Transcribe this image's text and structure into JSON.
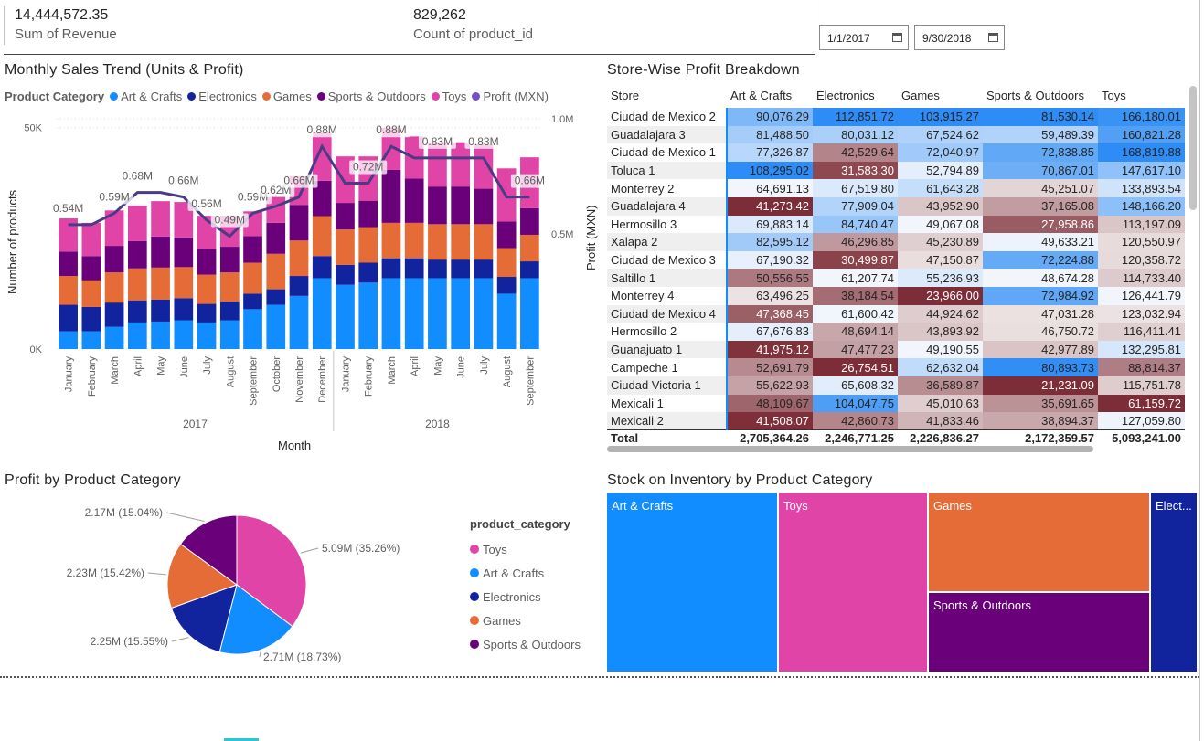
{
  "kpis": [
    {
      "value": "14,444,572.35",
      "label": "Sum of Revenue"
    },
    {
      "value": "829,262",
      "label": "Count of product_id"
    }
  ],
  "date_range": {
    "start": "1/1/2017",
    "end": "9/30/2018"
  },
  "colors": {
    "art_crafts": "#118DFF",
    "electronics": "#12239E",
    "games": "#E66C37",
    "sports_outdoors": "#6B007B",
    "toys": "#E044A7",
    "profit_line": "#744EC2"
  },
  "monthly": {
    "title": "Monthly Sales Trend (Units & Profit)",
    "legend_title": "Product Category",
    "legend": [
      "Art & Crafts",
      "Electronics",
      "Games",
      "Sports & Outdoors",
      "Toys",
      "Profit (MXN)"
    ],
    "ylabel": "Number of products",
    "xlabel": "Month",
    "y_ticks": [
      "0K",
      "50K"
    ],
    "y2_ticks": [
      "0.5M",
      "1.0M"
    ],
    "years": [
      "2017",
      "2018"
    ]
  },
  "chart_data": {
    "type": "bar",
    "stacked": true,
    "categories": [
      "January",
      "February",
      "March",
      "April",
      "May",
      "June",
      "July",
      "August",
      "September",
      "October",
      "November",
      "December",
      "January",
      "February",
      "March",
      "April",
      "May",
      "June",
      "July",
      "August",
      "September"
    ],
    "year_groups": [
      {
        "label": "2017",
        "count": 12
      },
      {
        "label": "2018",
        "count": 9
      }
    ],
    "ylim": [
      0,
      52000
    ],
    "y2lim": [
      0,
      1000000
    ],
    "series": [
      {
        "name": "Art & Crafts",
        "values": [
          4000,
          4000,
          5000,
          6000,
          6200,
          6500,
          6000,
          6500,
          9000,
          10000,
          12000,
          16000,
          14500,
          15000,
          16000,
          16000,
          16000,
          16000,
          16000,
          12500,
          16000
        ]
      },
      {
        "name": "Electronics",
        "values": [
          6000,
          5500,
          5500,
          5000,
          5000,
          5000,
          4200,
          4200,
          3500,
          3500,
          4500,
          5000,
          4500,
          4500,
          4500,
          4500,
          4200,
          4200,
          4200,
          3800,
          3800
        ]
      },
      {
        "name": "Games",
        "values": [
          6500,
          6000,
          6800,
          7200,
          7200,
          7000,
          6600,
          6600,
          7000,
          8000,
          8000,
          9000,
          8000,
          8000,
          8000,
          8000,
          8000,
          8000,
          8000,
          6500,
          6000
        ]
      },
      {
        "name": "Sports & Outdoors",
        "values": [
          5500,
          5500,
          6000,
          6200,
          7000,
          6700,
          5800,
          5800,
          6000,
          7000,
          8000,
          8000,
          6000,
          6000,
          12000,
          10000,
          8500,
          8500,
          8000,
          6000,
          6000
        ]
      },
      {
        "name": "Toys",
        "values": [
          7500,
          7500,
          8000,
          8000,
          8000,
          8000,
          7500,
          7000,
          5600,
          6000,
          6500,
          11000,
          10500,
          10000,
          9500,
          9500,
          10000,
          10000,
          10000,
          12000,
          11500
        ]
      }
    ],
    "line": {
      "name": "Profit (MXN)",
      "values": [
        540000,
        540000,
        590000,
        680000,
        680000,
        660000,
        560000,
        490000,
        590000,
        620000,
        660000,
        880000,
        720000,
        720000,
        880000,
        830000,
        830000,
        830000,
        830000,
        660000,
        660000
      ],
      "labels": [
        "0.54M",
        "",
        "0.59M",
        "0.68M",
        "",
        "0.66M",
        "0.56M",
        "0.49M",
        "0.59M",
        "0.62M",
        "0.66M",
        "0.88M",
        "",
        "0.72M",
        "0.88M",
        "",
        "0.83M",
        "",
        "0.83M",
        "",
        "0.66M"
      ]
    }
  },
  "store_table": {
    "title": "Store-Wise Profit Breakdown",
    "side_label": "Profit (MXN)",
    "columns": [
      "Store",
      "Art & Crafts",
      "Electronics",
      "Games",
      "Sports & Outdoors",
      "Toys"
    ],
    "rows": [
      [
        "Ciudad de Mexico 2",
        "90,076.29",
        "112,851.72",
        "103,915.27",
        "81,530.14",
        "166,180.01"
      ],
      [
        "Guadalajara 3",
        "81,488.50",
        "80,031.12",
        "67,524.62",
        "59,489.39",
        "160,821.28"
      ],
      [
        "Ciudad de Mexico 1",
        "77,326.87",
        "42,529.64",
        "72,040.97",
        "72,838.85",
        "168,819.88"
      ],
      [
        "Toluca 1",
        "108,295.02",
        "31,583.30",
        "52,794.89",
        "70,867.01",
        "147,617.10"
      ],
      [
        "Monterrey 2",
        "64,691.13",
        "67,519.80",
        "61,643.28",
        "45,251.07",
        "133,893.54"
      ],
      [
        "Guadalajara 4",
        "41,273.42",
        "77,909.04",
        "43,952.90",
        "37,165.08",
        "148,166.20"
      ],
      [
        "Hermosillo 3",
        "69,883.14",
        "84,740.47",
        "49,067.08",
        "27,958.86",
        "113,197.09"
      ],
      [
        "Xalapa 2",
        "82,595.12",
        "46,296.85",
        "45,230.89",
        "49,633.21",
        "120,550.97"
      ],
      [
        "Ciudad de Mexico 3",
        "67,190.32",
        "30,499.87",
        "47,150.87",
        "72,224.88",
        "120,358.72"
      ],
      [
        "Saltillo 1",
        "50,556.55",
        "61,207.74",
        "55,236.93",
        "48,674.28",
        "114,733.40"
      ],
      [
        "Monterrey 4",
        "63,496.25",
        "38,184.54",
        "23,966.00",
        "72,984.92",
        "126,441.79"
      ],
      [
        "Ciudad de Mexico 4",
        "47,368.45",
        "61,600.42",
        "44,924.62",
        "47,031.28",
        "123,032.94"
      ],
      [
        "Hermosillo 2",
        "67,676.83",
        "48,694.14",
        "43,893.92",
        "46,750.72",
        "116,411.41"
      ],
      [
        "Guanajuato 1",
        "41,975.12",
        "47,477.23",
        "49,190.55",
        "42,977.89",
        "132,295.81"
      ],
      [
        "Campeche 1",
        "52,691.79",
        "26,754.51",
        "62,632.04",
        "80,893.73",
        "88,814.37"
      ],
      [
        "Ciudad Victoria 1",
        "55,622.93",
        "65,608.32",
        "36,589.87",
        "21,231.09",
        "115,751.78"
      ],
      [
        "Mexicali 1",
        "48,109.67",
        "104,047.75",
        "45,010.63",
        "35,691.65",
        "61,159.72"
      ],
      [
        "Mexicali 2",
        "41,508.07",
        "42,860.73",
        "41,833.46",
        "38,894.37",
        "127,059.80"
      ]
    ],
    "total": [
      "Total",
      "2,705,364.26",
      "2,246,771.25",
      "2,226,836.27",
      "2,172,359.57",
      "5,093,241.00"
    ]
  },
  "pie": {
    "title": "Profit by Product Category",
    "legend_title": "product_category",
    "slices": [
      {
        "name": "Toys",
        "value": 5.09,
        "label": "5.09M (35.26%)"
      },
      {
        "name": "Art & Crafts",
        "value": 2.71,
        "label": "2.71M (18.73%)"
      },
      {
        "name": "Electronics",
        "value": 2.25,
        "label": "2.25M (15.55%)"
      },
      {
        "name": "Games",
        "value": 2.23,
        "label": "2.23M (15.42%)"
      },
      {
        "name": "Sports & Outdoors",
        "value": 2.17,
        "label": "2.17M (15.04%)"
      }
    ]
  },
  "treemap": {
    "title": "Stock on Inventory by Product Category",
    "tiles": [
      "Art & Crafts",
      "Toys",
      "Games",
      "Sports & Outdoors",
      "Elect..."
    ]
  }
}
